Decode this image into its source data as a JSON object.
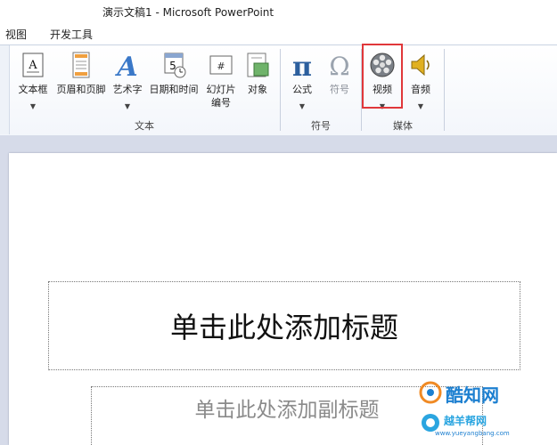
{
  "window": {
    "title": "演示文稿1 - Microsoft PowerPoint"
  },
  "menu": {
    "tabs": [
      "视图",
      "开发工具"
    ]
  },
  "ribbon": {
    "buttons": {
      "textbox": "文本框",
      "header_footer": "页眉和页脚",
      "wordart": "艺术字",
      "datetime": "日期和时间",
      "slide_number_1": "幻灯片",
      "slide_number_2": "编号",
      "object": "对象",
      "equation": "公式",
      "symbol": "符号",
      "video": "视频",
      "audio": "音频"
    },
    "groups": {
      "text": "文本",
      "symbols": "符号",
      "media": "媒体"
    }
  },
  "slide": {
    "title_placeholder": "单击此处添加标题",
    "subtitle_placeholder": "单击此处添加副标题"
  },
  "watermark": {
    "line1": "酷知网",
    "line2": "越羊帮网",
    "line3": "www.yueyangbang.com"
  },
  "colors": {
    "highlight": "#e0373a",
    "ribbon_bg": "#f3f6fb",
    "workspace": "#d6dbe9"
  },
  "icons": [
    "textbox-icon",
    "header-footer-icon",
    "wordart-icon",
    "datetime-icon",
    "slide-number-icon",
    "object-icon",
    "pi-icon",
    "omega-icon",
    "film-reel-icon",
    "speaker-icon"
  ]
}
